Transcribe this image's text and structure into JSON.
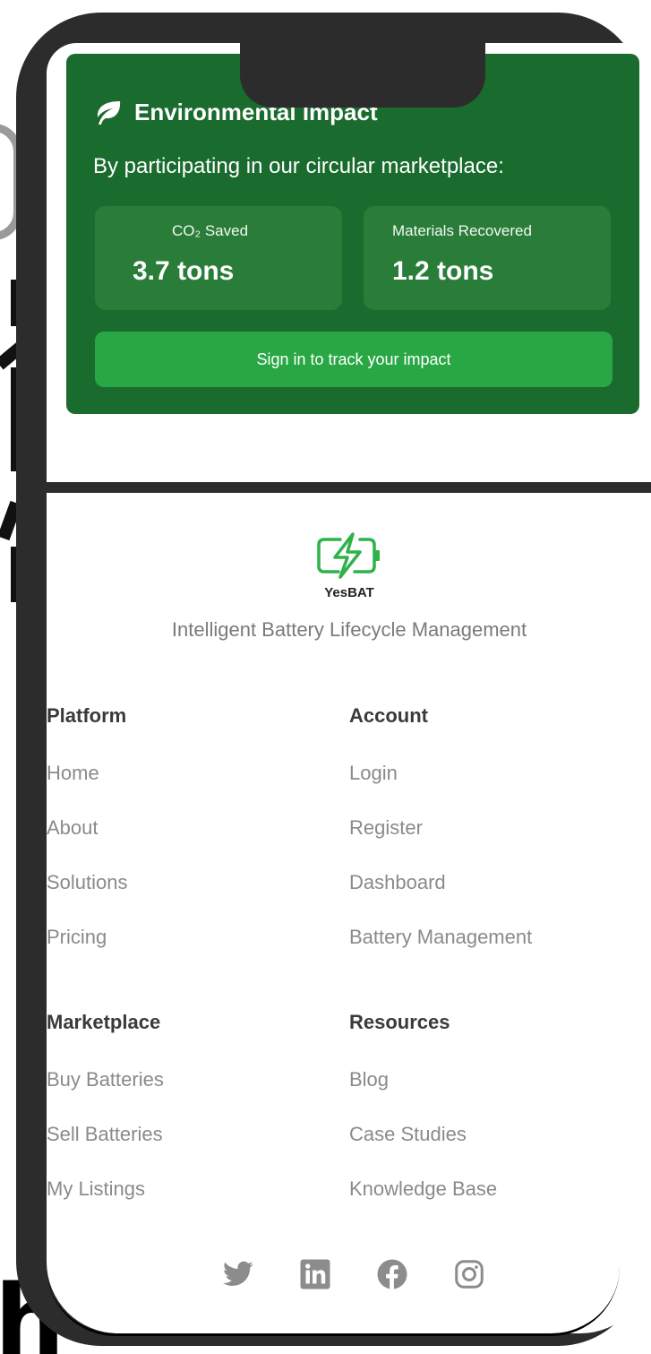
{
  "impact": {
    "title": "Environmental Impact",
    "intro": "By participating in our circular marketplace:",
    "co2_label": "CO₂ Saved",
    "co2_value": "3.7 tons",
    "materials_label": "Materials Recovered",
    "materials_value": "1.2 tons",
    "cta_label": "Sign in to track your impact"
  },
  "footer": {
    "brand_name": "YesBAT",
    "tagline": "Intelligent Battery Lifecycle Management",
    "columns": [
      {
        "heading": "Platform",
        "links": [
          "Home",
          "About",
          "Solutions",
          "Pricing"
        ]
      },
      {
        "heading": "Account",
        "links": [
          "Login",
          "Register",
          "Dashboard",
          "Battery Management"
        ]
      },
      {
        "heading": "Marketplace",
        "links": [
          "Buy Batteries",
          "Sell Batteries",
          "My Listings"
        ]
      },
      {
        "heading": "Resources",
        "links": [
          "Blog",
          "Case Studies",
          "Knowledge Base"
        ]
      }
    ],
    "social": [
      "twitter-icon",
      "linkedin-icon",
      "facebook-icon",
      "instagram-icon"
    ]
  },
  "colors": {
    "impact_bg": "#1a6b2e",
    "stat_bg": "#2a7d39",
    "cta_bg": "#29a745",
    "logo_green": "#2db34a"
  }
}
